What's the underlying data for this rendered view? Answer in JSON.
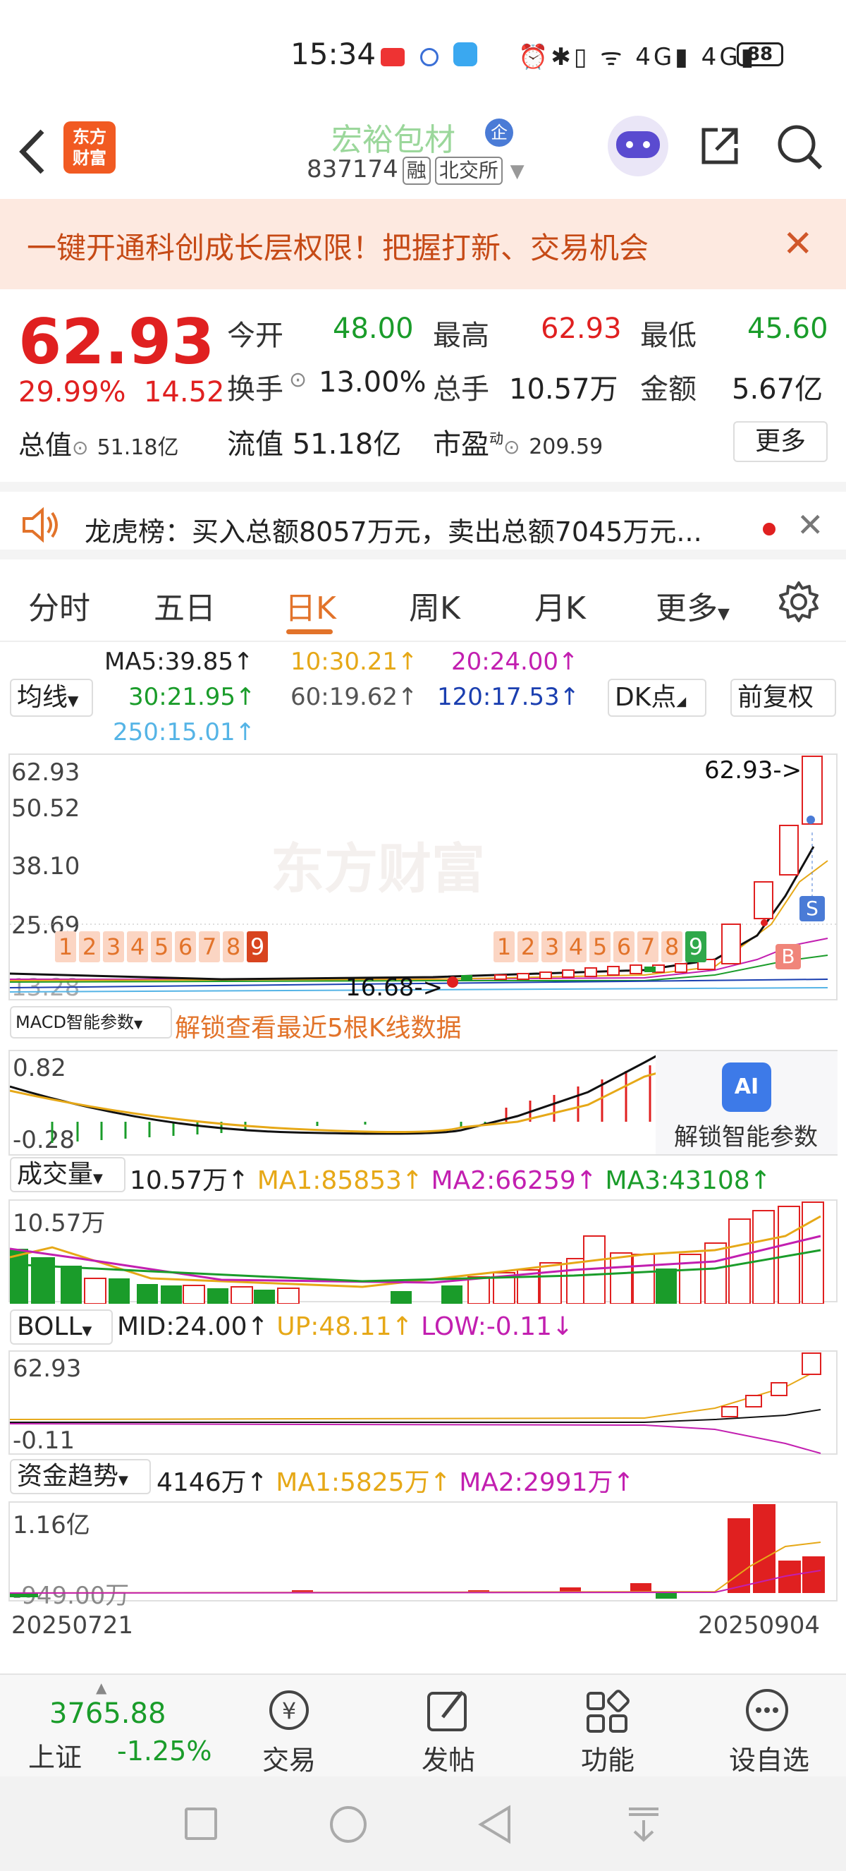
{
  "status_bar": {
    "time": "15:34",
    "battery": "88"
  },
  "header": {
    "logo": "东方\n财富",
    "stock_name": "宏裕包材",
    "badge": "企",
    "code": "837174",
    "tag_margin": "融",
    "exchange": "北交所"
  },
  "promo": {
    "text": "一键开通科创成长层权限！把握打新、交易机会"
  },
  "quote": {
    "price": "62.93",
    "change_pct": "29.99%",
    "change_amt": "14.52",
    "rows": [
      [
        {
          "label": "今开",
          "value": "48.00",
          "color": "green"
        },
        {
          "label": "最高",
          "value": "62.93",
          "color": "red"
        },
        {
          "label": "最低",
          "value": "45.60",
          "color": "green"
        }
      ],
      [
        {
          "label": "换手",
          "value": "13.00%",
          "color": "black"
        },
        {
          "label": "总手",
          "value": "10.57万",
          "color": "black"
        },
        {
          "label": "金额",
          "value": "5.67亿",
          "color": "black"
        }
      ]
    ],
    "total_mkt_label": "总值",
    "total_mkt": "51.18亿",
    "float_label": "流值",
    "float_val": "51.18亿",
    "pe_label": "市盈",
    "pe_sup": "动",
    "pe_val": "209.59",
    "more": "更多"
  },
  "dragon_tiger": {
    "text": "龙虎榜：买入总额8057万元，卖出总额7045万元..."
  },
  "tabs": [
    "分时",
    "五日",
    "日K",
    "周K",
    "月K",
    "更多"
  ],
  "active_tab": "日K",
  "ma_bar": {
    "selector": "均线",
    "items": [
      {
        "text": "MA5:39.85↑",
        "color": "#222"
      },
      {
        "text": "10:30.21↑",
        "color": "#e6a817"
      },
      {
        "text": "20:24.00↑",
        "color": "#c21fb0"
      },
      {
        "text": "30:21.95↑",
        "color": "#1a9c2a"
      },
      {
        "text": "60:19.62↑",
        "color": "#555"
      },
      {
        "text": "120:17.53↑",
        "color": "#1b3fb0"
      },
      {
        "text": "250:15.01↑",
        "color": "#55b4e6"
      }
    ],
    "dk_btn": "DK点",
    "adj_btn": "前复权"
  },
  "kline": {
    "y_labels": [
      "62.93",
      "50.52",
      "38.10",
      "25.69",
      "13.28"
    ],
    "high_note": "62.93->",
    "low_note": "16.68->",
    "seq1": [
      "1",
      "2",
      "3",
      "4",
      "5",
      "6",
      "7",
      "8",
      "9"
    ],
    "seq2": [
      "1",
      "2",
      "3",
      "4",
      "5",
      "6",
      "7",
      "8",
      "9"
    ],
    "watermark": "东方财富",
    "signal_s": "S",
    "signal_b": "B"
  },
  "macd": {
    "selector": "MACD智能参数",
    "unlock": "解锁查看最近5根K线数据",
    "y_top": "0.82",
    "y_bottom": "-0.28",
    "ai_label": "解锁智能参数",
    "ai_icon_text": "AI"
  },
  "volume": {
    "selector": "成交量",
    "current": "10.57万↑",
    "ma1": "MA1:85853↑",
    "ma2": "MA2:66259↑",
    "ma3": "MA3:43108↑",
    "y_top": "10.57万"
  },
  "boll": {
    "selector": "BOLL",
    "mid": "MID:24.00↑",
    "up": "UP:48.11↑",
    "low": "LOW:-0.11↓",
    "y_top": "62.93",
    "y_bottom": "-0.11"
  },
  "fund": {
    "selector": "资金趋势",
    "current": "4146万↑",
    "ma1": "MA1:5825万↑",
    "ma2": "MA2:2991万↑",
    "y_top": "1.16亿",
    "y_bottom": "-949.00万",
    "date_start": "20250721",
    "date_end": "20250904"
  },
  "bottom_nav": {
    "index_value": "3765.88",
    "index_name": "上证",
    "index_chg": "-1.25%",
    "items": [
      "交易",
      "发帖",
      "功能",
      "设自选"
    ]
  },
  "colors": {
    "up": "#e02020",
    "down": "#1a9c2a",
    "accent": "#e2732a"
  }
}
